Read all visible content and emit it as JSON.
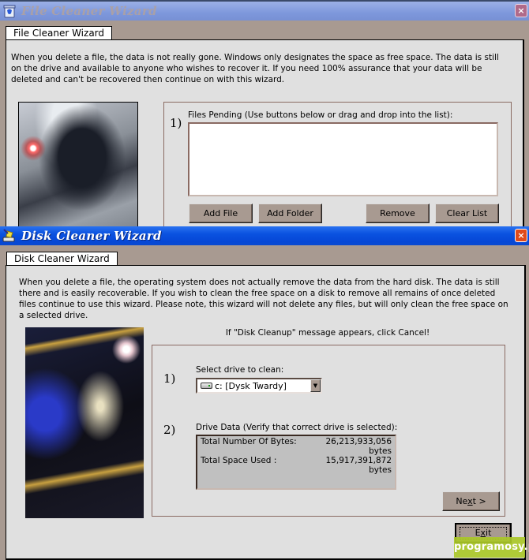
{
  "file_cleaner_window": {
    "title": "File Cleaner Wizard",
    "tab_label": "File Cleaner Wizard",
    "intro_text": "When you delete a file, the data is not really gone. Windows only designates the space as free space. The data is still on the drive and available to anyone who wishes to recover it. If you need 100% assurance that your data will be deleted and can't be recovered then continue on with this wizard.",
    "step1": {
      "number": "1)",
      "label": "Files Pending (Use buttons below or drag and drop into the list):",
      "files": []
    },
    "buttons": {
      "add_file": "Add File",
      "add_folder": "Add Folder",
      "remove": "Remove",
      "clear_list": "Clear List"
    },
    "close_label": "×"
  },
  "disk_cleaner_window": {
    "title": "Disk Cleaner Wizard",
    "tab_label": "Disk Cleaner Wizard",
    "intro_text": "When you delete a file, the operating system does not actually remove the data from the hard disk. The data is still there and is easily recoverable. If you wish to clean the free space on a disk to remove all remains of once deleted files continue to use this wizard. Please note, this wizard will not delete any files, but will only clean the free space on a selected drive.",
    "notice": "If \"Disk Cleanup\" message appears, click Cancel!",
    "step1": {
      "number": "1)",
      "label": "Select drive to clean:",
      "selected_drive": "c: [Dysk Twardy]",
      "drive_icon": "hard-drive-icon"
    },
    "step2": {
      "number": "2)",
      "label": "Drive Data (Verify that correct drive is selected):",
      "rows": [
        {
          "key": "Total Number Of Bytes:",
          "value": "26,213,933,056 bytes"
        },
        {
          "key": "Total Space Used :",
          "value": "15,917,391,872 bytes"
        }
      ]
    },
    "buttons": {
      "next_pre": "Ne",
      "next_acc": "x",
      "next_post": "t >",
      "exit_pre": "E",
      "exit_acc": "x",
      "exit_post": "it"
    },
    "close_label": "×"
  },
  "watermark": "programosy.pl"
}
